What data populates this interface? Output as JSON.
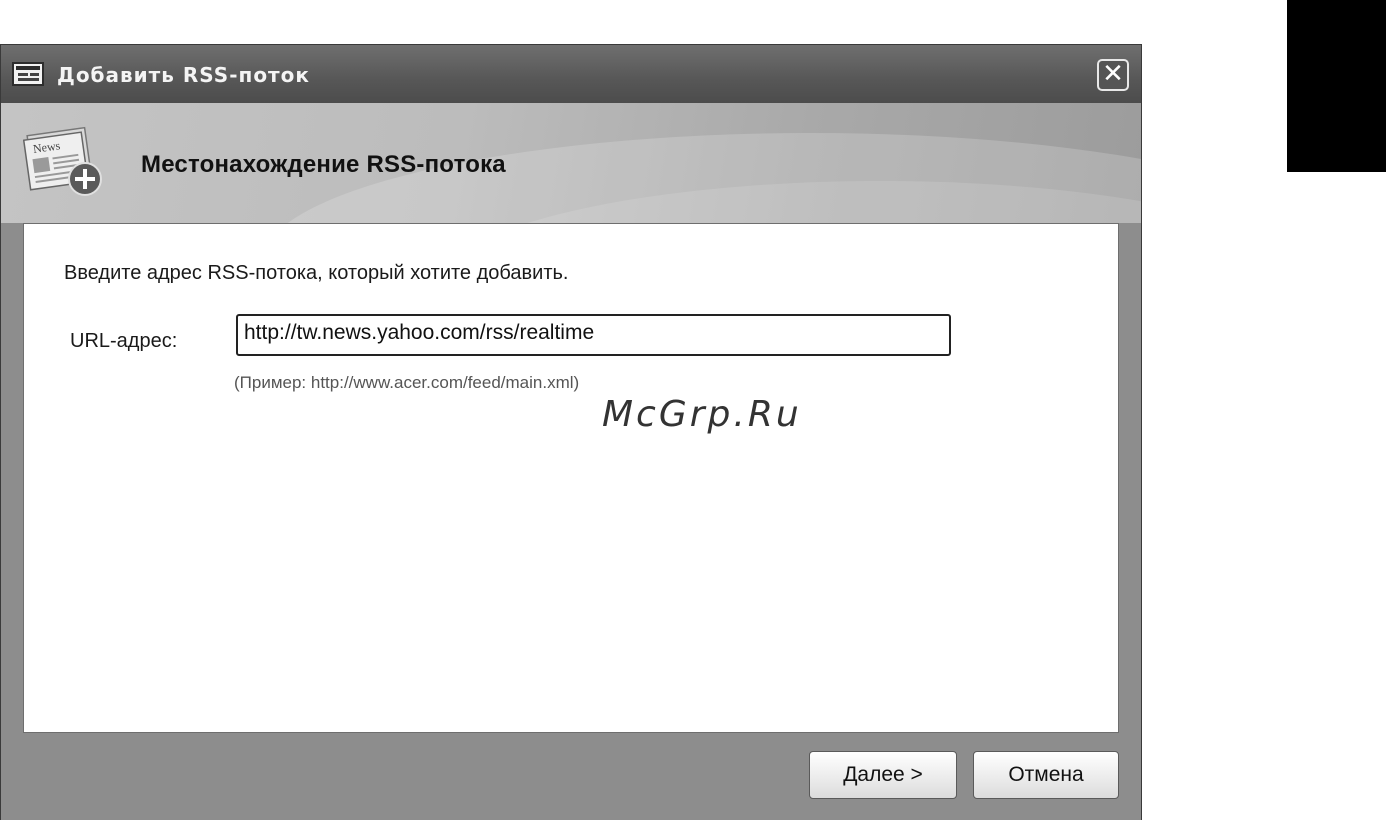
{
  "window": {
    "title": "Добавить RSS-поток",
    "close_label": "✕"
  },
  "header": {
    "title": "Местонахождение RSS-потока",
    "icon": "news-add-icon",
    "icon_text": "News"
  },
  "form": {
    "prompt": "Введите адрес RSS-потока, который хотите добавить.",
    "url_label": "URL-адрес:",
    "url_value": "http://tw.news.yahoo.com/rss/realtime",
    "example": "(Пример: http://www.acer.com/feed/main.xml)"
  },
  "watermark": "McGrp.Ru",
  "buttons": {
    "next_label": "Далее >",
    "cancel_label": "Отмена"
  }
}
